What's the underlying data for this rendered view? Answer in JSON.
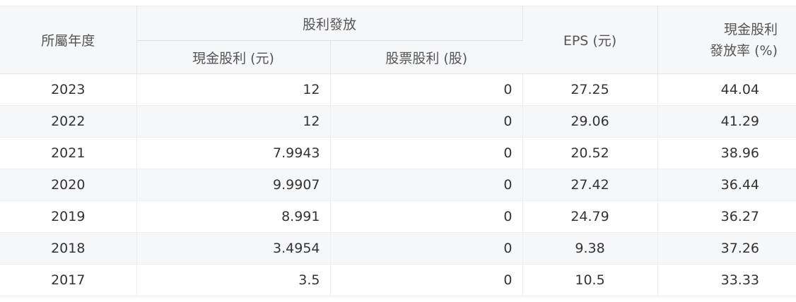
{
  "header": {
    "year": "所屬年度",
    "group": "股利發放",
    "cash_dividend": "現金股利 (元)",
    "stock_dividend": "股票股利 (股)",
    "eps": "EPS (元)",
    "payout_line1": "現金股利",
    "payout_line2": "發放率 (%)"
  },
  "rows": [
    {
      "year": "2023",
      "cash": "12",
      "stock": "0",
      "eps": "27.25",
      "payout": "44.04"
    },
    {
      "year": "2022",
      "cash": "12",
      "stock": "0",
      "eps": "29.06",
      "payout": "41.29"
    },
    {
      "year": "2021",
      "cash": "7.9943",
      "stock": "0",
      "eps": "20.52",
      "payout": "38.96"
    },
    {
      "year": "2020",
      "cash": "9.9907",
      "stock": "0",
      "eps": "27.42",
      "payout": "36.44"
    },
    {
      "year": "2019",
      "cash": "8.991",
      "stock": "0",
      "eps": "24.79",
      "payout": "36.27"
    },
    {
      "year": "2018",
      "cash": "3.4954",
      "stock": "0",
      "eps": "9.38",
      "payout": "37.26"
    },
    {
      "year": "2017",
      "cash": "3.5",
      "stock": "0",
      "eps": "10.5",
      "payout": "33.33"
    }
  ]
}
